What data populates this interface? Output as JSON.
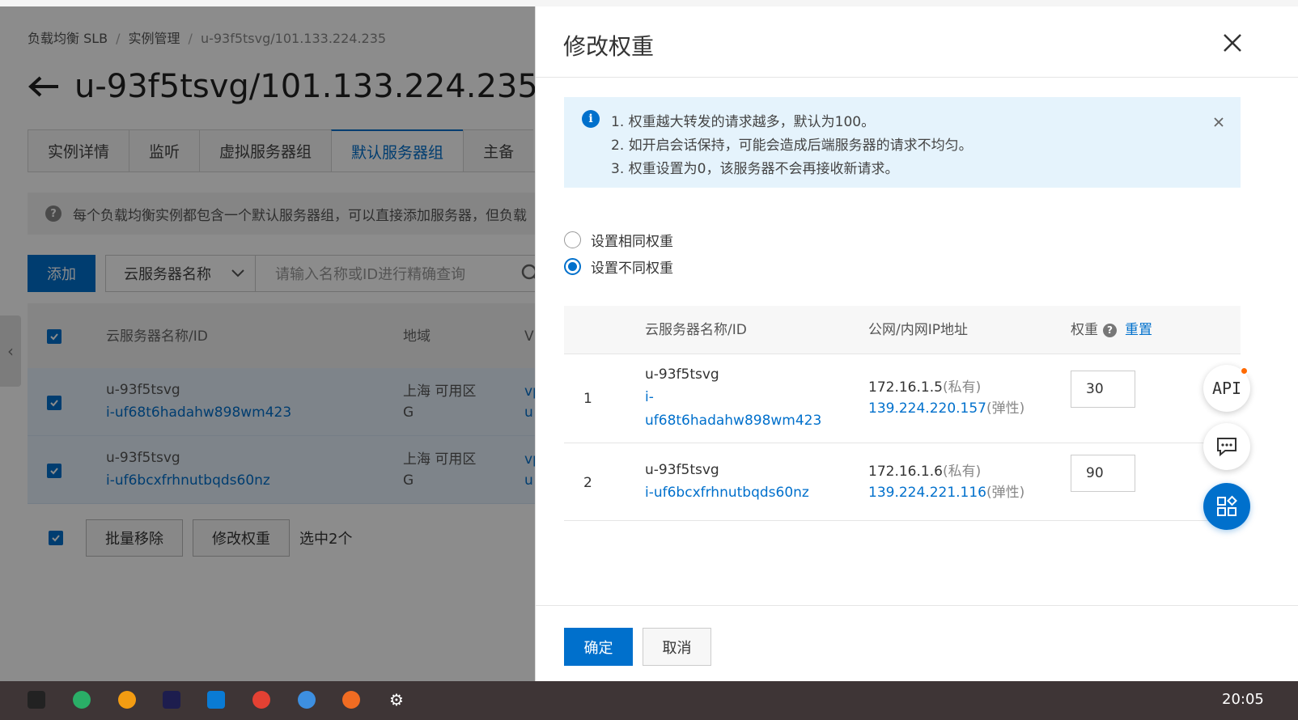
{
  "breadcrumb": {
    "items": [
      "负载均衡 SLB",
      "实例管理",
      "u-93f5tsvg/101.133.224.235"
    ]
  },
  "page": {
    "title": "u-93f5tsvg/101.133.224.235"
  },
  "tabs": [
    "实例详情",
    "监听",
    "虚拟服务器组",
    "默认服务器组",
    "主备"
  ],
  "notice": "每个负载均衡实例都包含一个默认服务器组，可以直接添加服务器，但负载",
  "toolbar": {
    "add_label": "添加",
    "select_value": "云服务器名称",
    "search_placeholder": "请输入名称或ID进行精确查询"
  },
  "bg_table": {
    "headers": [
      "云服务器名称/ID",
      "地域",
      "V"
    ],
    "rows": [
      {
        "name": "u-93f5tsvg",
        "id": "i-uf68t6hadahw898wm423",
        "region_line1": "上海 可用区",
        "region_line2": "G",
        "vpc1": "vp",
        "vpc2": "u"
      },
      {
        "name": "u-93f5tsvg",
        "id": "i-uf6bcxfrhnutbqds60nz",
        "region_line1": "上海 可用区",
        "region_line2": "G",
        "vpc1": "vp",
        "vpc2": "u"
      }
    ]
  },
  "bottom_actions": {
    "batch_remove": "批量移除",
    "modify_weight": "修改权重",
    "selected_text": "选中2个"
  },
  "drawer": {
    "title": "修改权重",
    "info": [
      "1. 权重越大转发的请求越多，默认为100。",
      "2. 如开启会话保持，可能会造成后端服务器的请求不均匀。",
      "3. 权重设置为0，该服务器不会再接收新请求。"
    ],
    "radio_same": "设置相同权重",
    "radio_diff": "设置不同权重",
    "table_headers": {
      "name": "云服务器名称/ID",
      "ip": "公网/内网IP地址",
      "weight": "权重",
      "reset": "重置"
    },
    "rows": [
      {
        "index": "1",
        "name": "u-93f5tsvg",
        "id_part1": "i-",
        "id_part2": "uf68t6hadahw898wm423",
        "private_ip": "172.16.1.5",
        "private_tag": "(私有)",
        "public_ip": "139.224.220.157",
        "public_tag": "(弹性)",
        "weight": "30"
      },
      {
        "index": "2",
        "name": "u-93f5tsvg",
        "id": "i-uf6bcxfrhnutbqds60nz",
        "private_ip": "172.16.1.6",
        "private_tag": "(私有)",
        "public_ip": "139.224.221.116",
        "public_tag": "(弹性)",
        "weight": "90"
      }
    ],
    "confirm_label": "确定",
    "cancel_label": "取消"
  },
  "floating": {
    "api_label": "API"
  },
  "taskbar": {
    "clock": "20:05"
  },
  "colors": {
    "accent": "#0070cc",
    "info_bg": "#e5f3fc",
    "dot": "#ff6a00"
  }
}
